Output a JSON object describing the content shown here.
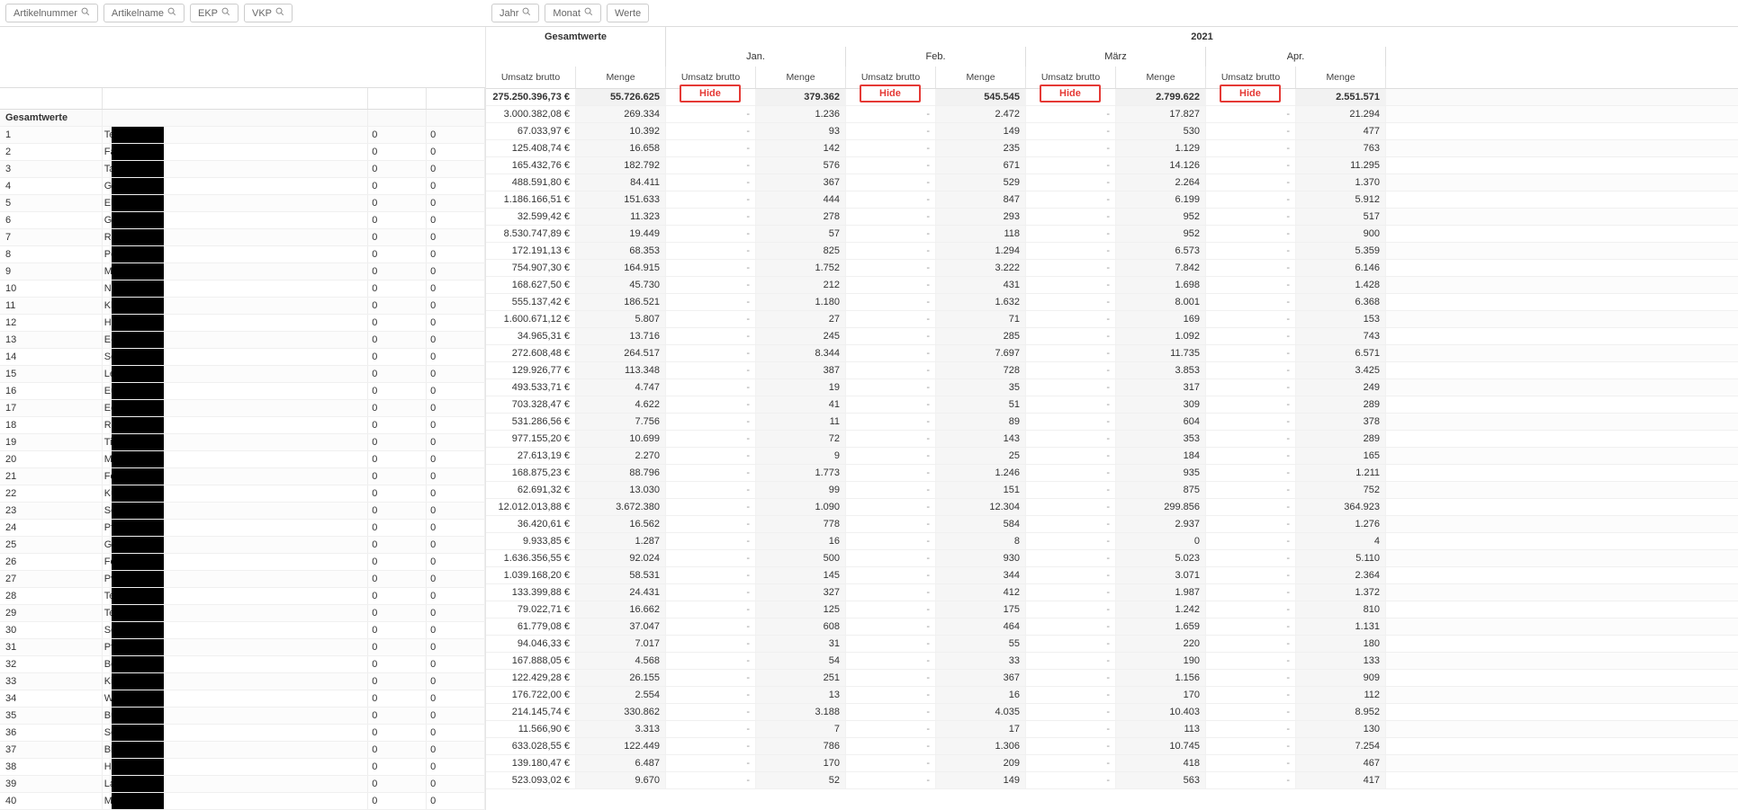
{
  "filters_left": [
    {
      "label": "Artikelnummer",
      "has_search": true
    },
    {
      "label": "Artikelname",
      "has_search": true
    },
    {
      "label": "EKP",
      "has_search": true
    },
    {
      "label": "VKP",
      "has_search": true
    }
  ],
  "filters_right": [
    {
      "label": "Jahr",
      "has_search": true
    },
    {
      "label": "Monat",
      "has_search": true
    },
    {
      "label": "Werte",
      "has_search": false
    }
  ],
  "header": {
    "totals_col_group": "Gesamtwerte",
    "year": "2021",
    "months": [
      "Jan.",
      "Feb.",
      "März",
      "Apr."
    ],
    "measure_ub": "Umsatz brutto",
    "measure_menge": "Menge",
    "hide_label": "Hide"
  },
  "totals_row_label": "Gesamtwerte",
  "totals_row": {
    "gesamt_ub": "275.250.396,73 €",
    "gesamt_menge": "55.726.625",
    "m": [
      {
        "ub": "",
        "menge": "379.362"
      },
      {
        "ub": "",
        "menge": "545.545"
      },
      {
        "ub": "",
        "menge": "2.799.622"
      },
      {
        "ub": "",
        "menge": "2.551.571"
      }
    ]
  },
  "rows": [
    {
      "n": "1",
      "name": "Te",
      "e": "0",
      "v": "0",
      "g_ub": "3.000.382,08 €",
      "g_m": "269.334",
      "m": [
        {
          "menge": "1.236"
        },
        {
          "menge": "2.472"
        },
        {
          "menge": "17.827"
        },
        {
          "menge": "21.294"
        }
      ]
    },
    {
      "n": "2",
      "name": "Fa",
      "e": "0",
      "v": "0",
      "g_ub": "67.033,97 €",
      "g_m": "10.392",
      "m": [
        {
          "menge": "93"
        },
        {
          "menge": "149"
        },
        {
          "menge": "530"
        },
        {
          "menge": "477"
        }
      ]
    },
    {
      "n": "3",
      "name": "Ta",
      "e": "0",
      "v": "0",
      "g_ub": "125.408,74 €",
      "g_m": "16.658",
      "m": [
        {
          "menge": "142"
        },
        {
          "menge": "235"
        },
        {
          "menge": "1.129"
        },
        {
          "menge": "763"
        }
      ]
    },
    {
      "n": "4",
      "name": "Ga",
      "e": "0",
      "v": "0",
      "g_ub": "165.432,76 €",
      "g_m": "182.792",
      "m": [
        {
          "menge": "576"
        },
        {
          "menge": "671"
        },
        {
          "menge": "14.126"
        },
        {
          "menge": "11.295"
        }
      ]
    },
    {
      "n": "5",
      "name": "El",
      "e": "0",
      "v": "0",
      "g_ub": "488.591,80 €",
      "g_m": "84.411",
      "m": [
        {
          "menge": "367"
        },
        {
          "menge": "529"
        },
        {
          "menge": "2.264"
        },
        {
          "menge": "1.370"
        }
      ]
    },
    {
      "n": "6",
      "name": "Ga",
      "e": "0",
      "v": "0",
      "g_ub": "1.186.166,51 €",
      "g_m": "151.633",
      "m": [
        {
          "menge": "444"
        },
        {
          "menge": "847"
        },
        {
          "menge": "6.199"
        },
        {
          "menge": "5.912"
        }
      ]
    },
    {
      "n": "7",
      "name": "Ra",
      "e": "0",
      "v": "0",
      "g_ub": "32.599,42 €",
      "g_m": "11.323",
      "m": [
        {
          "menge": "278"
        },
        {
          "menge": "293"
        },
        {
          "menge": "952"
        },
        {
          "menge": "517"
        }
      ]
    },
    {
      "n": "8",
      "name": "Po",
      "e": "0",
      "v": "0",
      "g_ub": "8.530.747,89 €",
      "g_m": "19.449",
      "m": [
        {
          "menge": "57"
        },
        {
          "menge": "118"
        },
        {
          "menge": "952"
        },
        {
          "menge": "900"
        }
      ]
    },
    {
      "n": "9",
      "name": "Ma",
      "e": "0",
      "v": "0",
      "g_ub": "172.191,13 €",
      "g_m": "68.353",
      "m": [
        {
          "menge": "825"
        },
        {
          "menge": "1.294"
        },
        {
          "menge": "6.573"
        },
        {
          "menge": "5.359"
        }
      ]
    },
    {
      "n": "10",
      "name": "No",
      "e": "0",
      "v": "0",
      "g_ub": "754.907,30 €",
      "g_m": "164.915",
      "m": [
        {
          "menge": "1.752"
        },
        {
          "menge": "3.222"
        },
        {
          "menge": "7.842"
        },
        {
          "menge": "6.146"
        }
      ]
    },
    {
      "n": "11",
      "name": "Kl",
      "e": "0",
      "v": "0",
      "g_ub": "168.627,50 €",
      "g_m": "45.730",
      "m": [
        {
          "menge": "212"
        },
        {
          "menge": "431"
        },
        {
          "menge": "1.698"
        },
        {
          "menge": "1.428"
        }
      ]
    },
    {
      "n": "12",
      "name": "Ha",
      "e": "0",
      "v": "0",
      "g_ub": "555.137,42 €",
      "g_m": "186.521",
      "m": [
        {
          "menge": "1.180"
        },
        {
          "menge": "1.632"
        },
        {
          "menge": "8.001"
        },
        {
          "menge": "6.368"
        }
      ]
    },
    {
      "n": "13",
      "name": "E-",
      "e": "0",
      "v": "0",
      "g_ub": "1.600.671,12 €",
      "g_m": "5.807",
      "m": [
        {
          "menge": "27"
        },
        {
          "menge": "71"
        },
        {
          "menge": "169"
        },
        {
          "menge": "153"
        }
      ]
    },
    {
      "n": "14",
      "name": "So",
      "e": "0",
      "v": "0",
      "g_ub": "34.965,31 €",
      "g_m": "13.716",
      "m": [
        {
          "menge": "245"
        },
        {
          "menge": "285"
        },
        {
          "menge": "1.092"
        },
        {
          "menge": "743"
        }
      ]
    },
    {
      "n": "15",
      "name": "Le",
      "e": "0",
      "v": "0",
      "g_ub": "272.608,48 €",
      "g_m": "264.517",
      "m": [
        {
          "menge": "8.344"
        },
        {
          "menge": "7.697"
        },
        {
          "menge": "11.735"
        },
        {
          "menge": "6.571"
        }
      ]
    },
    {
      "n": "16",
      "name": "Eu",
      "e": "0",
      "v": "0",
      "g_ub": "129.926,77 €",
      "g_m": "113.348",
      "m": [
        {
          "menge": "387"
        },
        {
          "menge": "728"
        },
        {
          "menge": "3.853"
        },
        {
          "menge": "3.425"
        }
      ]
    },
    {
      "n": "17",
      "name": "Ec",
      "e": "0",
      "v": "0",
      "g_ub": "493.533,71 €",
      "g_m": "4.747",
      "m": [
        {
          "menge": "19"
        },
        {
          "menge": "35"
        },
        {
          "menge": "317"
        },
        {
          "menge": "249"
        }
      ]
    },
    {
      "n": "18",
      "name": "Re",
      "e": "0",
      "v": "0",
      "g_ub": "703.328,47 €",
      "g_m": "4.622",
      "m": [
        {
          "menge": "41"
        },
        {
          "menge": "51"
        },
        {
          "menge": "309"
        },
        {
          "menge": "289"
        }
      ]
    },
    {
      "n": "19",
      "name": "Ti",
      "e": "0",
      "v": "0",
      "g_ub": "531.286,56 €",
      "g_m": "7.756",
      "m": [
        {
          "menge": "11"
        },
        {
          "menge": "89"
        },
        {
          "menge": "604"
        },
        {
          "menge": "378"
        }
      ]
    },
    {
      "n": "20",
      "name": "Ma",
      "e": "0",
      "v": "0",
      "g_ub": "977.155,20 €",
      "g_m": "10.699",
      "m": [
        {
          "menge": "72"
        },
        {
          "menge": "143"
        },
        {
          "menge": "353"
        },
        {
          "menge": "289"
        }
      ]
    },
    {
      "n": "21",
      "name": "Fo",
      "e": "0",
      "v": "0",
      "g_ub": "27.613,19 €",
      "g_m": "2.270",
      "m": [
        {
          "menge": "9"
        },
        {
          "menge": "25"
        },
        {
          "menge": "184"
        },
        {
          "menge": "165"
        }
      ]
    },
    {
      "n": "22",
      "name": "Kü",
      "e": "0",
      "v": "0",
      "g_ub": "168.875,23 €",
      "g_m": "88.796",
      "m": [
        {
          "menge": "1.773"
        },
        {
          "menge": "1.246"
        },
        {
          "menge": "935"
        },
        {
          "menge": "1.211"
        }
      ]
    },
    {
      "n": "23",
      "name": "Sc",
      "e": "0",
      "v": "0",
      "g_ub": "62.691,32 €",
      "g_m": "13.030",
      "m": [
        {
          "menge": "99"
        },
        {
          "menge": "151"
        },
        {
          "menge": "875"
        },
        {
          "menge": "752"
        }
      ]
    },
    {
      "n": "24",
      "name": "Pfl",
      "e": "0",
      "v": "0",
      "g_ub": "12.012.013,88 €",
      "g_m": "3.672.380",
      "m": [
        {
          "menge": "1.090"
        },
        {
          "menge": "12.304"
        },
        {
          "menge": "299.856"
        },
        {
          "menge": "364.923"
        }
      ]
    },
    {
      "n": "25",
      "name": "Gl",
      "e": "0",
      "v": "0",
      "g_ub": "36.420,61 €",
      "g_m": "16.562",
      "m": [
        {
          "menge": "778"
        },
        {
          "menge": "584"
        },
        {
          "menge": "2.937"
        },
        {
          "menge": "1.276"
        }
      ]
    },
    {
      "n": "26",
      "name": "Fe",
      "e": "0",
      "v": "0",
      "g_ub": "9.933,85 €",
      "g_m": "1.287",
      "m": [
        {
          "menge": "16"
        },
        {
          "menge": "8"
        },
        {
          "menge": "0"
        },
        {
          "menge": "4"
        }
      ]
    },
    {
      "n": "27",
      "name": "Pv",
      "e": "0",
      "v": "0",
      "g_ub": "1.636.356,55 €",
      "g_m": "92.024",
      "m": [
        {
          "menge": "500"
        },
        {
          "menge": "930"
        },
        {
          "menge": "5.023"
        },
        {
          "menge": "5.110"
        }
      ]
    },
    {
      "n": "28",
      "name": "Te",
      "e": "0",
      "v": "0",
      "g_ub": "1.039.168,20 €",
      "g_m": "58.531",
      "m": [
        {
          "menge": "145"
        },
        {
          "menge": "344"
        },
        {
          "menge": "3.071"
        },
        {
          "menge": "2.364"
        }
      ]
    },
    {
      "n": "29",
      "name": "Te",
      "e": "0",
      "v": "0",
      "g_ub": "133.399,88 €",
      "g_m": "24.431",
      "m": [
        {
          "menge": "327"
        },
        {
          "menge": "412"
        },
        {
          "menge": "1.987"
        },
        {
          "menge": "1.372"
        }
      ]
    },
    {
      "n": "30",
      "name": "So",
      "e": "0",
      "v": "0",
      "g_ub": "79.022,71 €",
      "g_m": "16.662",
      "m": [
        {
          "menge": "125"
        },
        {
          "menge": "175"
        },
        {
          "menge": "1.242"
        },
        {
          "menge": "810"
        }
      ]
    },
    {
      "n": "31",
      "name": "Pfl",
      "e": "0",
      "v": "0",
      "g_ub": "61.779,08 €",
      "g_m": "37.047",
      "m": [
        {
          "menge": "608"
        },
        {
          "menge": "464"
        },
        {
          "menge": "1.659"
        },
        {
          "menge": "1.131"
        }
      ]
    },
    {
      "n": "32",
      "name": "Be",
      "e": "0",
      "v": "0",
      "g_ub": "94.046,33 €",
      "g_m": "7.017",
      "m": [
        {
          "menge": "31"
        },
        {
          "menge": "55"
        },
        {
          "menge": "220"
        },
        {
          "menge": "180"
        }
      ]
    },
    {
      "n": "33",
      "name": "Ki",
      "e": "0",
      "v": "0",
      "g_ub": "167.888,05 €",
      "g_m": "4.568",
      "m": [
        {
          "menge": "54"
        },
        {
          "menge": "33"
        },
        {
          "menge": "190"
        },
        {
          "menge": "133"
        }
      ]
    },
    {
      "n": "34",
      "name": "Wi",
      "e": "0",
      "v": "0",
      "g_ub": "122.429,28 €",
      "g_m": "26.155",
      "m": [
        {
          "menge": "251"
        },
        {
          "menge": "367"
        },
        {
          "menge": "1.156"
        },
        {
          "menge": "909"
        }
      ]
    },
    {
      "n": "35",
      "name": "Bü",
      "e": "0",
      "v": "0",
      "g_ub": "176.722,00 €",
      "g_m": "2.554",
      "m": [
        {
          "menge": "13"
        },
        {
          "menge": "16"
        },
        {
          "menge": "170"
        },
        {
          "menge": "112"
        }
      ]
    },
    {
      "n": "36",
      "name": "Sc",
      "e": "0",
      "v": "0",
      "g_ub": "214.145,74 €",
      "g_m": "330.862",
      "m": [
        {
          "menge": "3.188"
        },
        {
          "menge": "4.035"
        },
        {
          "menge": "10.403"
        },
        {
          "menge": "8.952"
        }
      ]
    },
    {
      "n": "37",
      "name": "Bil",
      "e": "0",
      "v": "0",
      "g_ub": "11.566,90 €",
      "g_m": "3.313",
      "m": [
        {
          "menge": "7"
        },
        {
          "menge": "17"
        },
        {
          "menge": "113"
        },
        {
          "menge": "130"
        }
      ]
    },
    {
      "n": "38",
      "name": "He",
      "e": "0",
      "v": "0",
      "g_ub": "633.028,55 €",
      "g_m": "122.449",
      "m": [
        {
          "menge": "786"
        },
        {
          "menge": "1.306"
        },
        {
          "menge": "10.745"
        },
        {
          "menge": "7.254"
        }
      ]
    },
    {
      "n": "39",
      "name": "La",
      "e": "0",
      "v": "0",
      "g_ub": "139.180,47 €",
      "g_m": "6.487",
      "m": [
        {
          "menge": "170"
        },
        {
          "menge": "209"
        },
        {
          "menge": "418"
        },
        {
          "menge": "467"
        }
      ]
    },
    {
      "n": "40",
      "name": "Mo",
      "e": "0",
      "v": "0",
      "g_ub": "523.093,02 €",
      "g_m": "9.670",
      "m": [
        {
          "menge": "52"
        },
        {
          "menge": "149"
        },
        {
          "menge": "563"
        },
        {
          "menge": "417"
        }
      ]
    }
  ]
}
